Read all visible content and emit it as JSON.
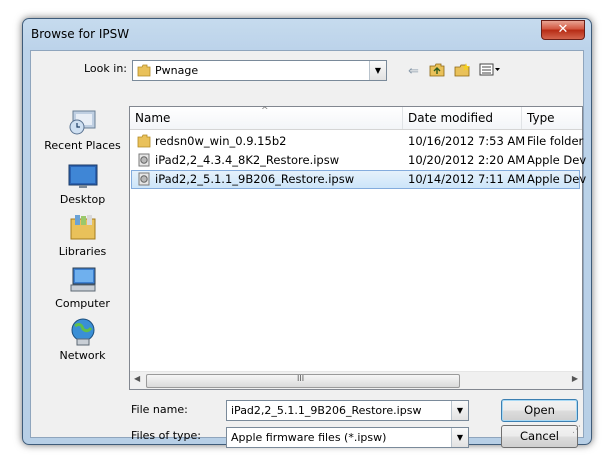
{
  "window": {
    "title": "Browse for IPSW",
    "close_glyph": "✕"
  },
  "lookin": {
    "label": "Look in:",
    "value": "Pwnage"
  },
  "places": [
    {
      "label": "Recent Places",
      "icon": "recent-places-icon"
    },
    {
      "label": "Desktop",
      "icon": "desktop-icon"
    },
    {
      "label": "Libraries",
      "icon": "libraries-icon"
    },
    {
      "label": "Computer",
      "icon": "computer-icon"
    },
    {
      "label": "Network",
      "icon": "network-icon"
    }
  ],
  "columns": [
    "Name",
    "Date modified",
    "Type"
  ],
  "files": [
    {
      "name": "redsn0w_win_0.9.15b2",
      "date": "10/16/2012 7:53 AM",
      "type": "File folder",
      "kind": "folder"
    },
    {
      "name": "iPad2,2_4.3.4_8K2_Restore.ipsw",
      "date": "10/20/2012 2:20 AM",
      "type": "Apple Dev",
      "kind": "file"
    },
    {
      "name": "iPad2,2_5.1.1_9B206_Restore.ipsw",
      "date": "10/14/2012 7:11 AM",
      "type": "Apple Dev",
      "kind": "file",
      "selected": true
    }
  ],
  "filename": {
    "label": "File name:",
    "value": "iPad2,2_5.1.1_9B206_Restore.ipsw"
  },
  "filetype": {
    "label": "Files of type:",
    "value": "Apple firmware files (*.ipsw)"
  },
  "buttons": {
    "open": "Open",
    "cancel": "Cancel"
  },
  "scroll_thumb_glyph": "III",
  "sort_glyph": "^",
  "colors": {
    "selection": "#cde5f9",
    "titlebar": "#bcd3ea",
    "close": "#c7442b"
  }
}
